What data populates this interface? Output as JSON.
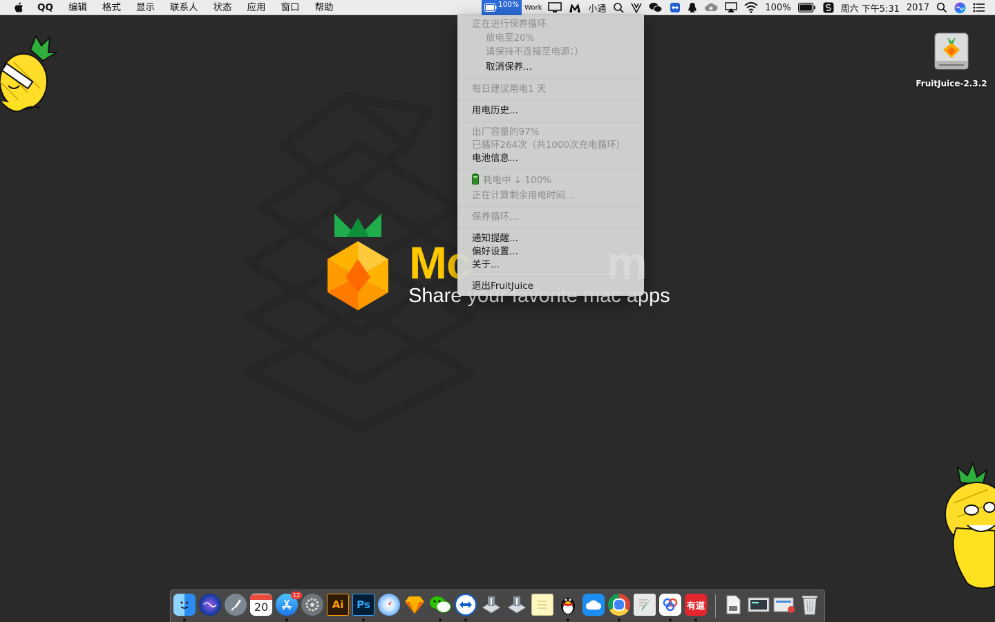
{
  "menubar": {
    "app_name": "QQ",
    "menus": [
      "编辑",
      "格式",
      "显示",
      "联系人",
      "状态",
      "应用",
      "窗口",
      "帮助"
    ],
    "fruitjuice_pct": "100%",
    "work_label": "Work",
    "xiaotong_label": "小通",
    "battery_pct": "100%",
    "datetime": "周六 下午5:31",
    "year": "2017"
  },
  "watermark": {
    "title_prefix": "Mc",
    "title_suffix": "m",
    "tagline": "Share your favorite mac apps"
  },
  "desktop_icon": {
    "label": "FruitJuice-2.3.2"
  },
  "dropdown": {
    "maintenance_header": "正在进行保养循环",
    "discharge_to": "放电至20%",
    "keep_unplugged": "请保持不连接至电源：）",
    "cancel_maintenance": "取消保养...",
    "daily_recommend": "每日建议用电1 天",
    "usage_history": "用电历史...",
    "factory_capacity": "出厂容量的97%",
    "cycles": "已循环264次（共1000次充电循环）",
    "battery_info": "电池信息...",
    "draining": "耗电中 ↓ 100%",
    "calculating": "正在计算剩余用电时间...",
    "maintenance_cycle": "保养循环...",
    "notifications": "通知提醒...",
    "preferences": "偏好设置...",
    "about": "关于...",
    "quit": "退出FruitJuice"
  },
  "dock": {
    "calendar_day": "20",
    "appstore_badge": "12",
    "ai_label": "Ai",
    "ps_label": "Ps",
    "youdao_label": "有道"
  },
  "colors": {
    "desktop_bg": "#2a2a2a",
    "menubar_bg": "#ececec",
    "highlight": "#2d6bd6",
    "brand_yellow": "#ffc800"
  }
}
